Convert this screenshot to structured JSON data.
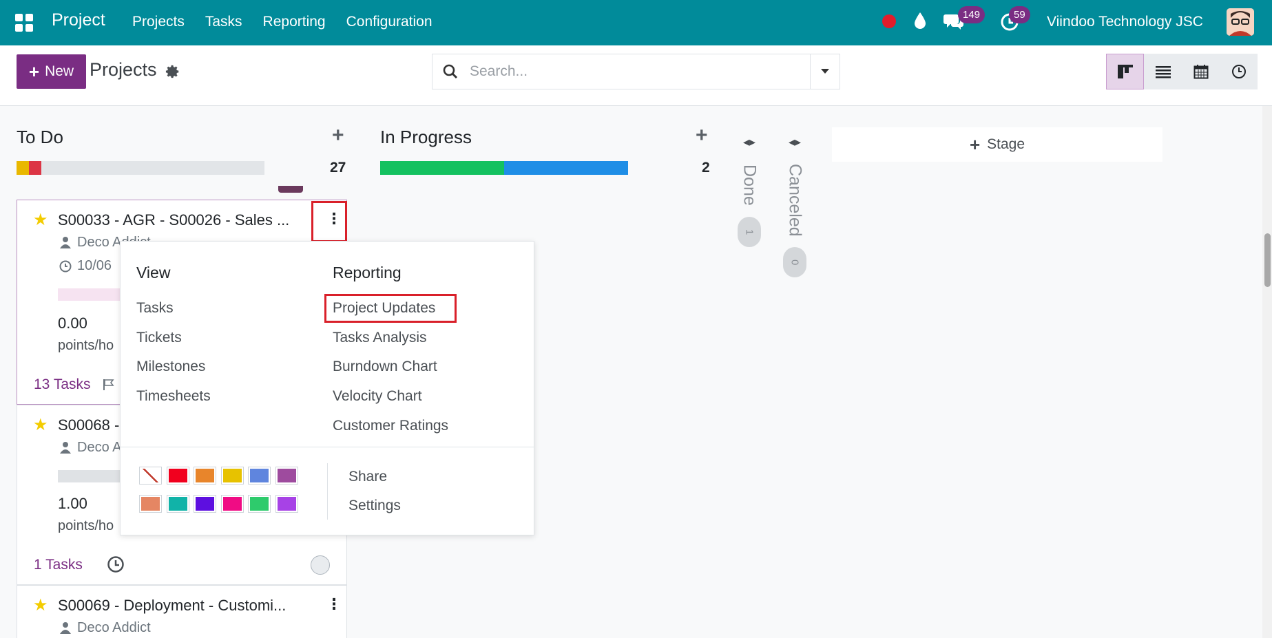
{
  "navbar": {
    "app_title": "Project",
    "menu": [
      "Projects",
      "Tasks",
      "Reporting",
      "Configuration"
    ],
    "messages_count": "149",
    "activities_count": "59",
    "company": "Viindoo Technology JSC"
  },
  "control": {
    "new_label": "New",
    "page_title": "Projects",
    "search_placeholder": "Search..."
  },
  "columns": {
    "todo": {
      "title": "To Do",
      "count": "27"
    },
    "in_progress": {
      "title": "In Progress",
      "count": "2"
    },
    "done": {
      "title": "Done",
      "count": "1"
    },
    "canceled": {
      "title": "Canceled",
      "count": "0"
    },
    "add_stage": "Stage"
  },
  "cards": [
    {
      "title": "S00033 - AGR - S00026 - Sales ...",
      "customer": "Deco Addict",
      "date": "10/06",
      "value": "0.00",
      "unit": "points/ho",
      "tasks": "13 Tasks"
    },
    {
      "title": "S00068 -",
      "customer": "Deco A",
      "value": "1.00",
      "unit": "points/ho",
      "tasks": "1 Tasks"
    },
    {
      "title": "S00069 - Deployment - Customi...",
      "customer": "Deco Addict"
    }
  ],
  "dropdown": {
    "view_header": "View",
    "view_items": [
      "Tasks",
      "Tickets",
      "Milestones",
      "Timesheets"
    ],
    "reporting_header": "Reporting",
    "reporting_items": [
      "Project Updates",
      "Tasks Analysis",
      "Burndown Chart",
      "Velocity Chart",
      "Customer Ratings"
    ],
    "actions": [
      "Share",
      "Settings"
    ],
    "colors": [
      "#ffffff",
      "#f1001e",
      "#e8852b",
      "#e7c200",
      "#5f85de",
      "#9e4b9e",
      "#e58663",
      "#11b3a8",
      "#5d0fe0",
      "#f00c84",
      "#2ecb6c",
      "#a742e6"
    ]
  },
  "colors": {
    "navbar": "#018b9a",
    "primary": "#7a2d83",
    "highlight": "#d9202a"
  }
}
